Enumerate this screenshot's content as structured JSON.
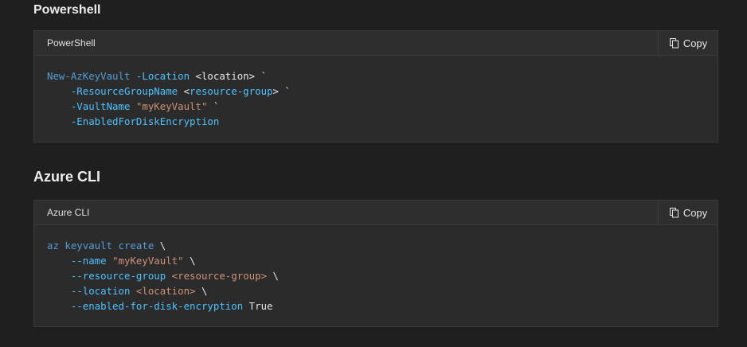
{
  "sections": [
    {
      "title": "Powershell",
      "block": {
        "language": "PowerShell",
        "copy_label": "Copy",
        "lines": [
          [
            {
              "t": "cmd",
              "v": "New-AzKeyVault"
            },
            {
              "t": "txt",
              "v": " "
            },
            {
              "t": "param",
              "v": "-Location"
            },
            {
              "t": "txt",
              "v": " <location> `"
            }
          ],
          [
            {
              "t": "txt",
              "v": "    "
            },
            {
              "t": "param",
              "v": "-ResourceGroupName"
            },
            {
              "t": "txt",
              "v": " <"
            },
            {
              "t": "param",
              "v": "resource-group"
            },
            {
              "t": "txt",
              "v": "> `"
            }
          ],
          [
            {
              "t": "txt",
              "v": "    "
            },
            {
              "t": "param",
              "v": "-VaultName"
            },
            {
              "t": "txt",
              "v": " "
            },
            {
              "t": "str",
              "v": "\"myKeyVault\""
            },
            {
              "t": "txt",
              "v": " `"
            }
          ],
          [
            {
              "t": "txt",
              "v": "    "
            },
            {
              "t": "param",
              "v": "-EnabledForDiskEncryption"
            }
          ]
        ]
      }
    },
    {
      "title": "Azure CLI",
      "block": {
        "language": "Azure CLI",
        "copy_label": "Copy",
        "lines": [
          [
            {
              "t": "cmd",
              "v": "az keyvault create"
            },
            {
              "t": "txt",
              "v": " \\"
            }
          ],
          [
            {
              "t": "txt",
              "v": "    "
            },
            {
              "t": "param",
              "v": "--name"
            },
            {
              "t": "txt",
              "v": " "
            },
            {
              "t": "str",
              "v": "\"myKeyVault\""
            },
            {
              "t": "txt",
              "v": " \\"
            }
          ],
          [
            {
              "t": "txt",
              "v": "    "
            },
            {
              "t": "param",
              "v": "--resource-group"
            },
            {
              "t": "txt",
              "v": " "
            },
            {
              "t": "ph",
              "v": "<resource-group>"
            },
            {
              "t": "txt",
              "v": " \\"
            }
          ],
          [
            {
              "t": "txt",
              "v": "    "
            },
            {
              "t": "param",
              "v": "--location"
            },
            {
              "t": "txt",
              "v": " "
            },
            {
              "t": "ph",
              "v": "<location>"
            },
            {
              "t": "txt",
              "v": " \\"
            }
          ],
          [
            {
              "t": "txt",
              "v": "    "
            },
            {
              "t": "param",
              "v": "--enabled-for-disk-encryption"
            },
            {
              "t": "txt",
              "v": " True"
            }
          ]
        ]
      }
    }
  ],
  "icons": {
    "copy": "copy-icon"
  },
  "colors": {
    "background": "#1f1f1f",
    "code_background": "#2b2b2b",
    "command": "#569cd6",
    "parameter": "#4fc1ff",
    "string": "#ce9178"
  }
}
